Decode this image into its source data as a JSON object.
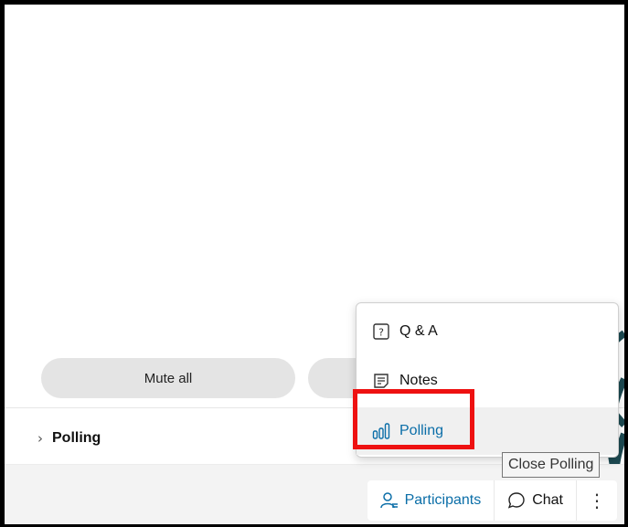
{
  "controls": {
    "mute_all_label": "Mute all"
  },
  "panel": {
    "section_label": "Polling"
  },
  "menu": {
    "items": [
      {
        "label": "Q & A",
        "icon": "question-box-icon"
      },
      {
        "label": "Notes",
        "icon": "notes-icon"
      },
      {
        "label": "Polling",
        "icon": "polling-bars-icon",
        "selected": true
      }
    ]
  },
  "tooltip": {
    "text": "Close Polling"
  },
  "footer": {
    "participants_label": "Participants",
    "chat_label": "Chat",
    "more_label": "⋮"
  },
  "colors": {
    "accent": "#0b6ea8",
    "highlight": "#ee1111"
  }
}
